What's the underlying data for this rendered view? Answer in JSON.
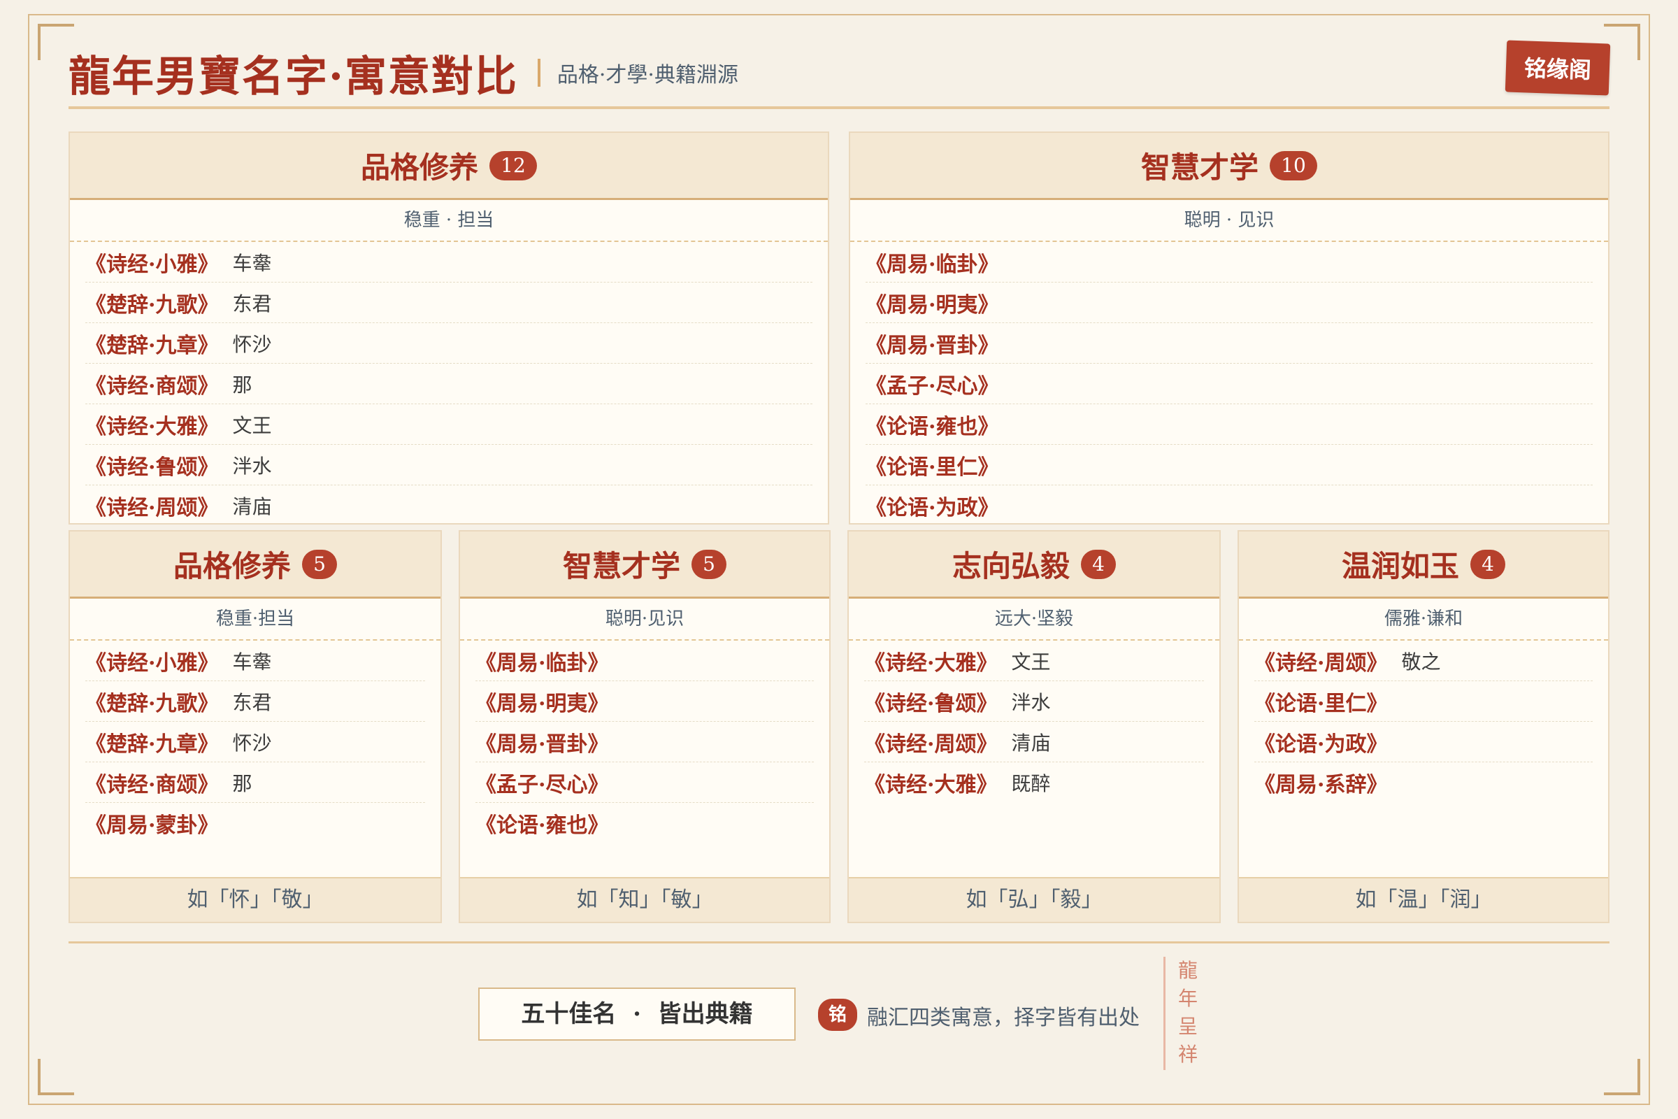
{
  "header": {
    "title": "龍年男寶名字·寓意對比",
    "subtitle": "品格·才學·典籍淵源",
    "seal": "铭缘阁"
  },
  "top_cards": [
    {
      "title": "品格修养",
      "count": "12",
      "sub": "稳重 · 担当",
      "items": [
        {
          "book": "《诗经·小雅》",
          "word": "车舝"
        },
        {
          "book": "《楚辞·九歌》",
          "word": "东君"
        },
        {
          "book": "《楚辞·九章》",
          "word": "怀沙"
        },
        {
          "book": "《诗经·商颂》",
          "word": "那"
        },
        {
          "book": "《诗经·大雅》",
          "word": "文王"
        },
        {
          "book": "《诗经·鲁颂》",
          "word": "泮水"
        },
        {
          "book": "《诗经·周颂》",
          "word": "清庙"
        }
      ]
    },
    {
      "title": "智慧才学",
      "count": "10",
      "sub": "聪明 · 见识",
      "items": [
        {
          "book": "《周易·临卦》",
          "word": ""
        },
        {
          "book": "《周易·明夷》",
          "word": ""
        },
        {
          "book": "《周易·晋卦》",
          "word": ""
        },
        {
          "book": "《孟子·尽心》",
          "word": ""
        },
        {
          "book": "《论语·雍也》",
          "word": ""
        },
        {
          "book": "《论语·里仁》",
          "word": ""
        },
        {
          "book": "《论语·为政》",
          "word": ""
        }
      ]
    }
  ],
  "bottom_cards": [
    {
      "title": "品格修养",
      "count": "5",
      "sub": "稳重·担当",
      "foot": "如「怀」「敬」",
      "items": [
        {
          "book": "《诗经·小雅》",
          "word": "车舝"
        },
        {
          "book": "《楚辞·九歌》",
          "word": "东君"
        },
        {
          "book": "《楚辞·九章》",
          "word": "怀沙"
        },
        {
          "book": "《诗经·商颂》",
          "word": "那"
        },
        {
          "book": "《周易·蒙卦》",
          "word": ""
        }
      ]
    },
    {
      "title": "智慧才学",
      "count": "5",
      "sub": "聪明·见识",
      "foot": "如「知」「敏」",
      "items": [
        {
          "book": "《周易·临卦》",
          "word": ""
        },
        {
          "book": "《周易·明夷》",
          "word": ""
        },
        {
          "book": "《周易·晋卦》",
          "word": ""
        },
        {
          "book": "《孟子·尽心》",
          "word": ""
        },
        {
          "book": "《论语·雍也》",
          "word": ""
        }
      ]
    },
    {
      "title": "志向弘毅",
      "count": "4",
      "sub": "远大·坚毅",
      "foot": "如「弘」「毅」",
      "items": [
        {
          "book": "《诗经·大雅》",
          "word": "文王"
        },
        {
          "book": "《诗经·鲁颂》",
          "word": "泮水"
        },
        {
          "book": "《诗经·周颂》",
          "word": "清庙"
        },
        {
          "book": "《诗经·大雅》",
          "word": "既醉"
        }
      ]
    },
    {
      "title": "温润如玉",
      "count": "4",
      "sub": "儒雅·谦和",
      "foot": "如「温」「润」",
      "items": [
        {
          "book": "《诗经·周颂》",
          "word": "敬之"
        },
        {
          "book": "《论语·里仁》",
          "word": ""
        },
        {
          "book": "《论语·为政》",
          "word": ""
        },
        {
          "book": "《周易·系辞》",
          "word": ""
        }
      ]
    }
  ],
  "footer": {
    "box": "五十佳名  ·  皆出典籍",
    "seal": "铭",
    "note": "融汇四类寓意，择字皆有出处",
    "vertical": "龍\n年\n呈\n祥"
  }
}
